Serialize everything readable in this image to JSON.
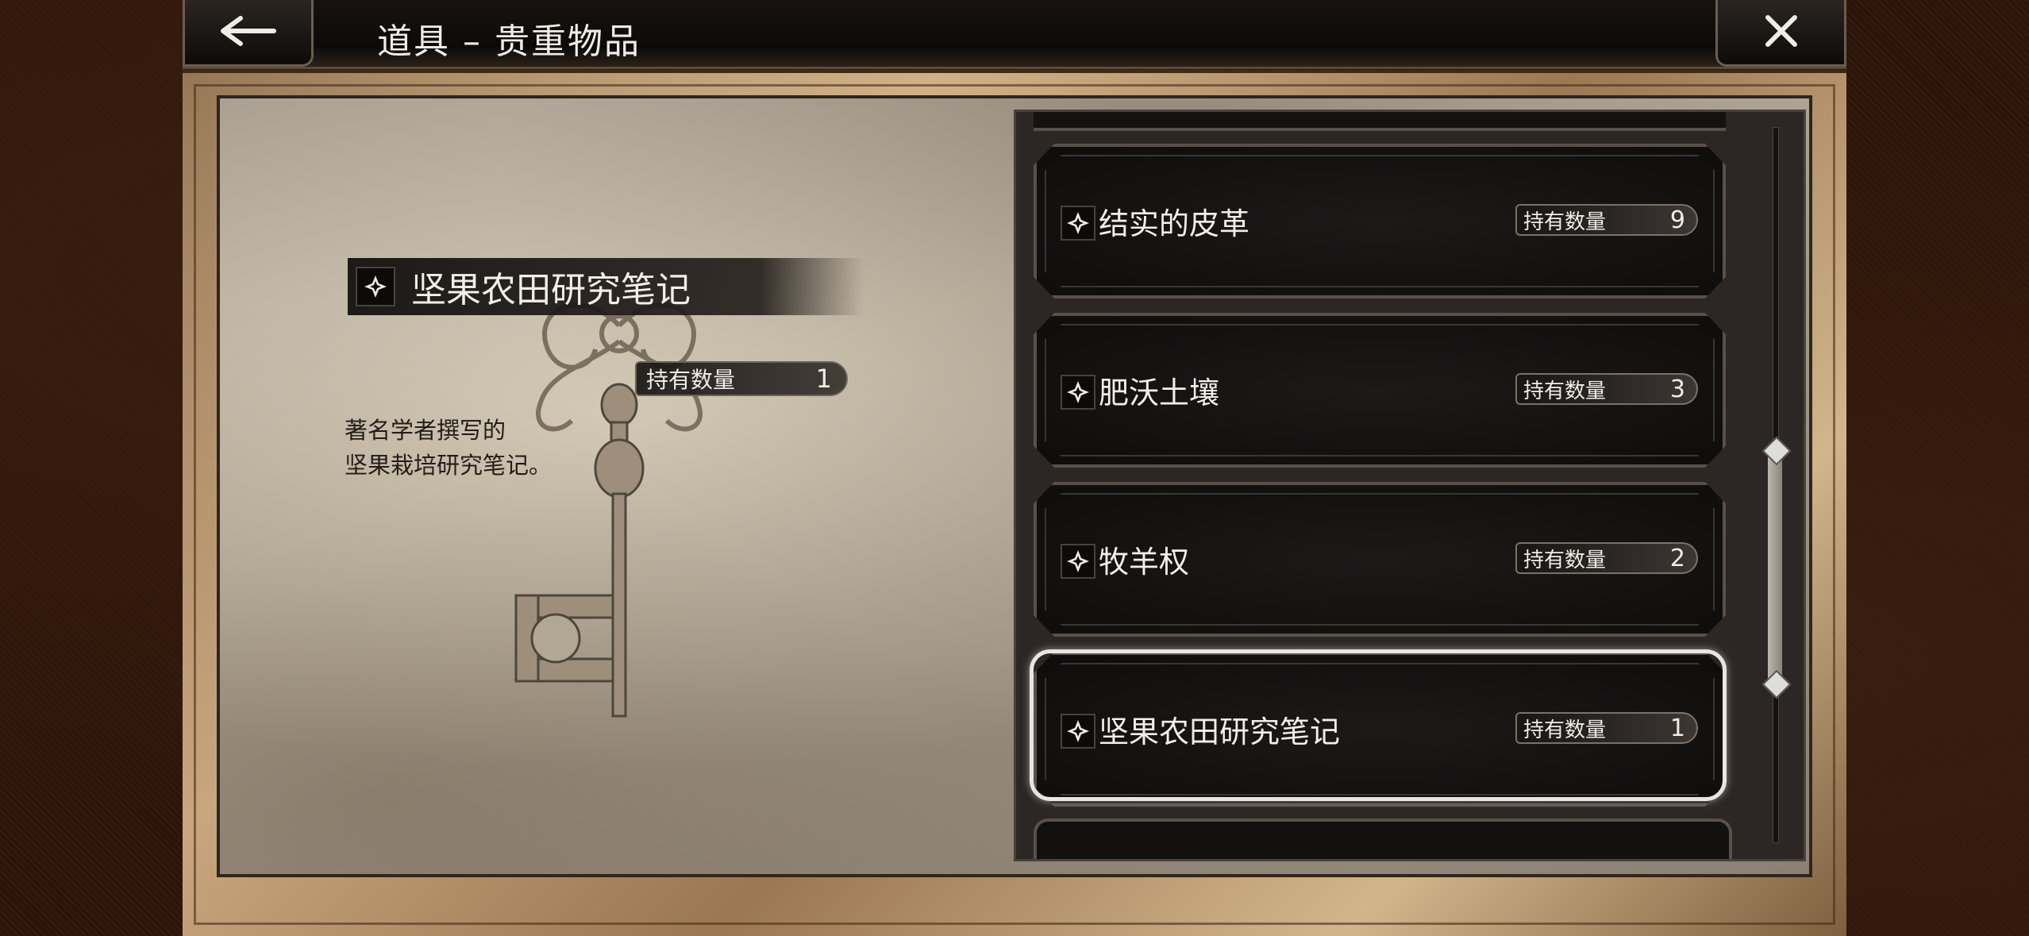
{
  "header": {
    "title": "道具 – 贵重物品",
    "back_icon": "back-arrow-icon",
    "close_icon": "close-icon"
  },
  "detail": {
    "name": "坚果农田研究笔记",
    "qty_label": "持有数量",
    "qty_value": "1",
    "description": "著名学者撰写的\n坚果栽培研究笔记。",
    "image_icon": "ornate-key-icon"
  },
  "items": [
    {
      "name": "结实的皮革",
      "qty_label": "持有数量",
      "qty_value": "9"
    },
    {
      "name": "肥沃土壤",
      "qty_label": "持有数量",
      "qty_value": "3"
    },
    {
      "name": "牧羊权",
      "qty_label": "持有数量",
      "qty_value": "2"
    },
    {
      "name": "坚果农田研究笔记",
      "qty_label": "持有数量",
      "qty_value": "1",
      "selected": true
    }
  ],
  "colors": {
    "text": "#f2efe9",
    "panel": "#2c2724",
    "selection": "#e8e6e2"
  }
}
